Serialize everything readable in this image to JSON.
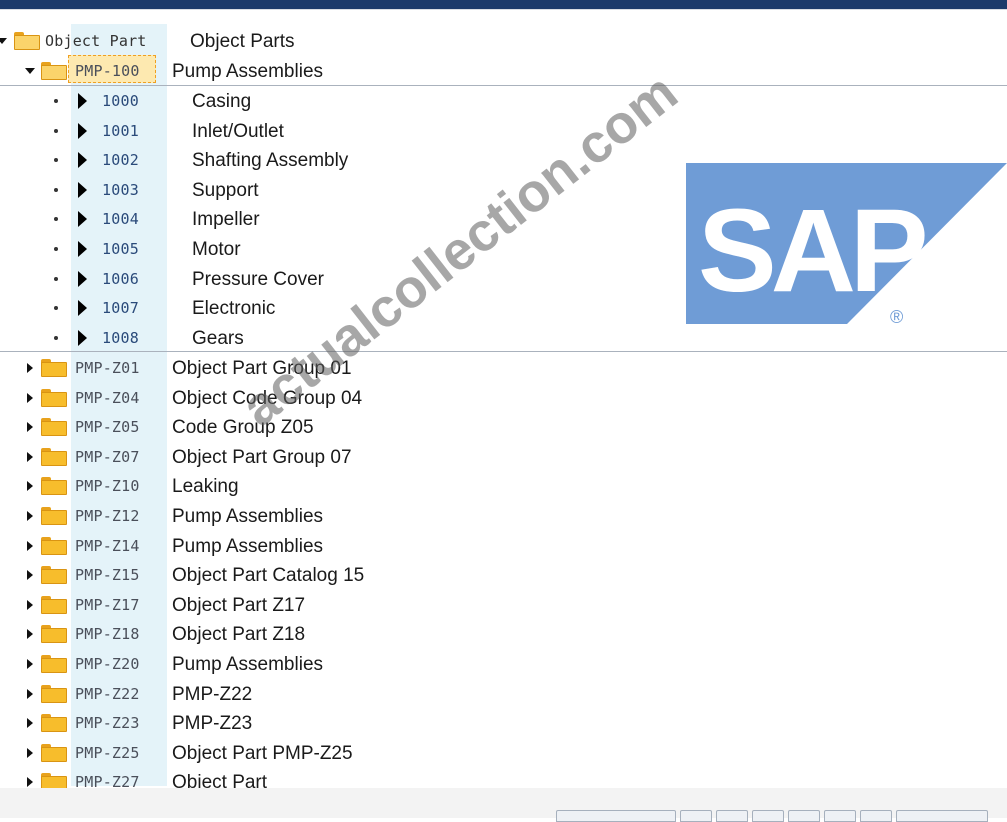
{
  "colors": {
    "top_bar": "#1c3a6b",
    "code_column": "#e4f3f9",
    "folder": "#f7bd2c",
    "sap_logo": "#6f9cd6"
  },
  "header": {
    "icon": "folder-open-icon",
    "code": "Object Part",
    "label": "Object Parts"
  },
  "selected_node": {
    "code": "PMP-100",
    "label": "Pump Assemblies"
  },
  "children": [
    {
      "code": "1000",
      "label": "Casing"
    },
    {
      "code": "1001",
      "label": "Inlet/Outlet"
    },
    {
      "code": "1002",
      "label": "Shafting Assembly"
    },
    {
      "code": "1003",
      "label": "Support"
    },
    {
      "code": "1004",
      "label": "Impeller"
    },
    {
      "code": "1005",
      "label": "Motor"
    },
    {
      "code": "1006",
      "label": "Pressure Cover"
    },
    {
      "code": "1007",
      "label": "Electronic"
    },
    {
      "code": "1008",
      "label": "Gears"
    }
  ],
  "groups": [
    {
      "code": "PMP-Z01",
      "label": "Object Part Group 01"
    },
    {
      "code": "PMP-Z04",
      "label": "Object Code Group 04"
    },
    {
      "code": "PMP-Z05",
      "label": "Code Group Z05"
    },
    {
      "code": "PMP-Z07",
      "label": "Object Part Group 07"
    },
    {
      "code": "PMP-Z10",
      "label": "Leaking"
    },
    {
      "code": "PMP-Z12",
      "label": "Pump Assemblies"
    },
    {
      "code": "PMP-Z14",
      "label": "Pump Assemblies"
    },
    {
      "code": "PMP-Z15",
      "label": "Object Part Catalog 15"
    },
    {
      "code": "PMP-Z17",
      "label": "Object Part Z17"
    },
    {
      "code": "PMP-Z18",
      "label": "Object Part Z18"
    },
    {
      "code": "PMP-Z20",
      "label": "Pump Assemblies"
    },
    {
      "code": "PMP-Z22",
      "label": "PMP-Z22"
    },
    {
      "code": "PMP-Z23",
      "label": "PMP-Z23"
    },
    {
      "code": "PMP-Z25",
      "label": "Object Part PMP-Z25"
    },
    {
      "code": "PMP-Z27",
      "label": "Object Part"
    }
  ],
  "logo": {
    "text": "SAP",
    "mark": "®"
  },
  "watermark": "actualcollection.com"
}
